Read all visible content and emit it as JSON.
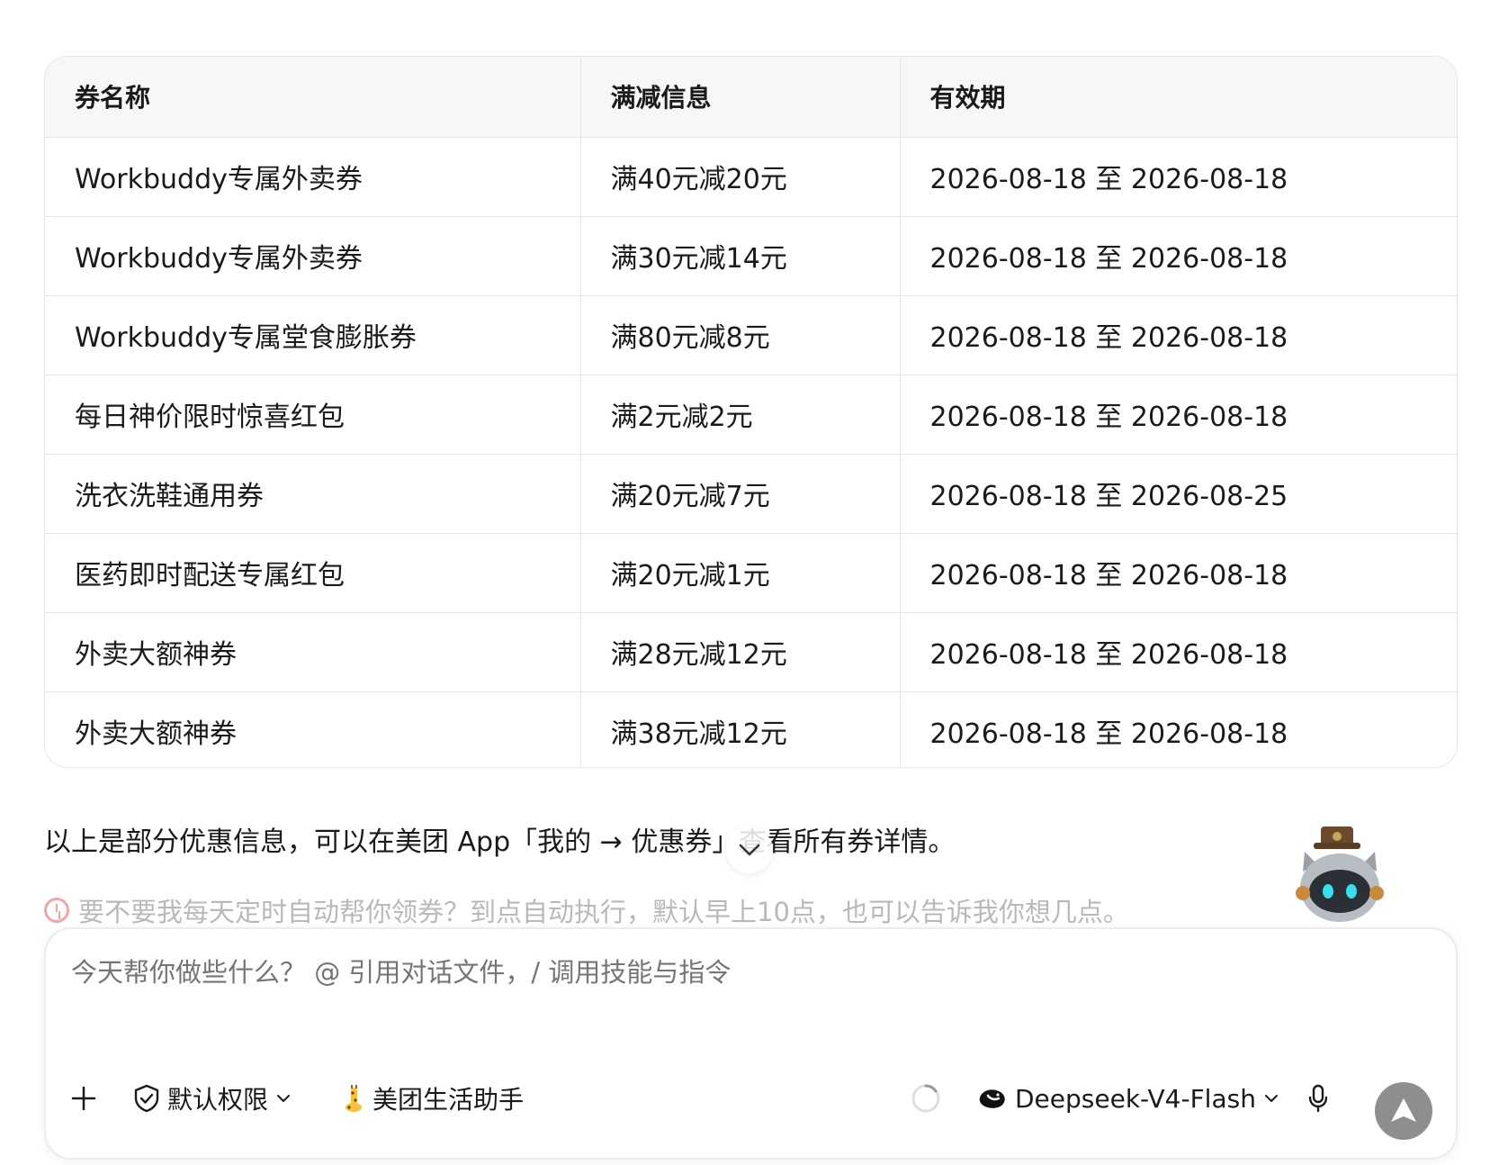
{
  "table": {
    "headers": [
      "券名称",
      "满减信息",
      "有效期"
    ],
    "rows": [
      [
        "Workbuddy专属外卖券",
        "满40元减20元",
        "2026-08-18 至 2026-08-18"
      ],
      [
        "Workbuddy专属外卖券",
        "满30元减14元",
        "2026-08-18 至 2026-08-18"
      ],
      [
        "Workbuddy专属堂食膨胀券",
        "满80元减8元",
        "2026-08-18 至 2026-08-18"
      ],
      [
        "每日神价限时惊喜红包",
        "满2元减2元",
        "2026-08-18 至 2026-08-18"
      ],
      [
        "洗衣洗鞋通用券",
        "满20元减7元",
        "2026-08-18 至 2026-08-25"
      ],
      [
        "医药即时配送专属红包",
        "满20元减1元",
        "2026-08-18 至 2026-08-18"
      ],
      [
        "外卖大额神券",
        "满28元减12元",
        "2026-08-18 至 2026-08-18"
      ],
      [
        "外卖大额神券",
        "满38元减12元",
        "2026-08-18 至 2026-08-18"
      ]
    ]
  },
  "summary_text": "以上是部分优惠信息，可以在美团 App「我的 → 优惠券」查看所有券详情。",
  "suggestion_text": "要不要我每天定时自动帮你领券？到点自动执行，默认早上10点，也可以告诉我你想几点。",
  "composer": {
    "placeholder": "今天帮你做些什么？ @ 引用对话文件，/ 调用技能与指令",
    "permission_label": "默认权限",
    "assistant_label": "美团生活助手",
    "model_label": "Deepseek-V4-Flash"
  },
  "icons": {
    "add": "plus-icon",
    "permission": "shield-check-icon",
    "assistant": "giraffe-icon",
    "status": "loading-spinner-icon",
    "model": "deepseek-whale-icon",
    "voice": "microphone-icon",
    "send": "send-arrow-icon",
    "scroll": "chevron-down-icon",
    "alarm": "alarm-clock-icon"
  },
  "colors": {
    "send_button": "#8e8e8e",
    "suggestion_text": "#b9b9b9",
    "table_header_bg": "#f7f7f7"
  }
}
